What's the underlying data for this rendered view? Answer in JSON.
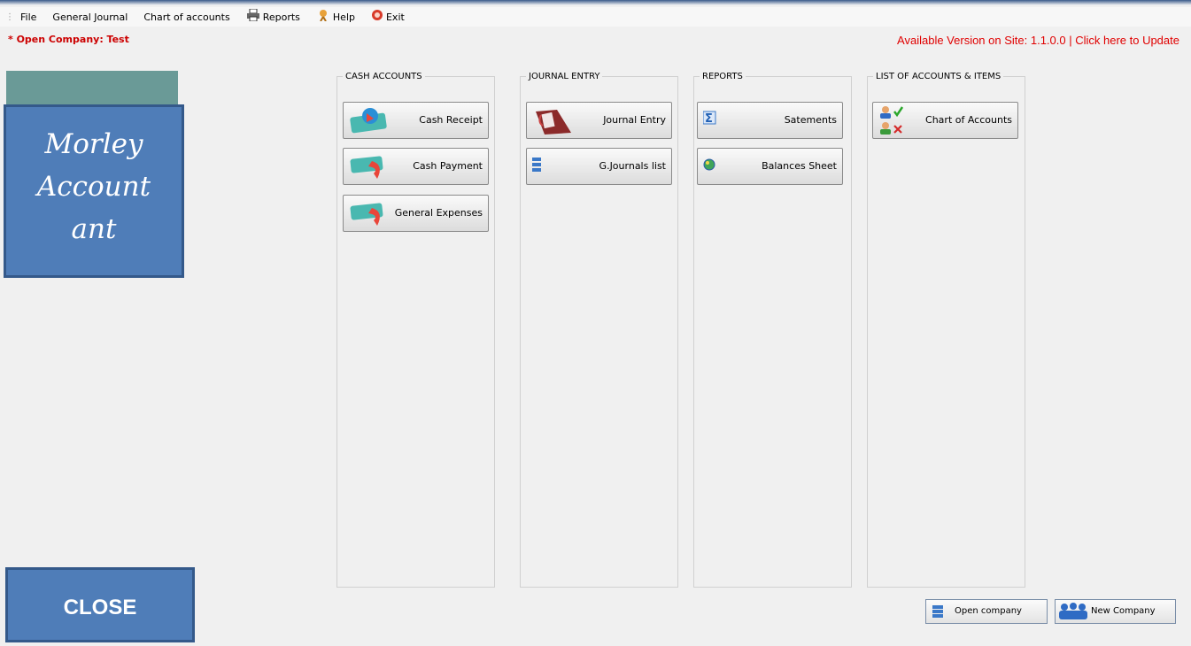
{
  "menu": {
    "items": [
      {
        "label": "File",
        "icon": ""
      },
      {
        "label": "General Journal",
        "icon": ""
      },
      {
        "label": "Chart of accounts",
        "icon": ""
      },
      {
        "label": "Reports",
        "icon": "printer-icon"
      },
      {
        "label": "Help",
        "icon": "help-icon"
      },
      {
        "label": "Exit",
        "icon": "exit-icon"
      }
    ]
  },
  "header": {
    "open_company": "* Open Company: Test",
    "update_notice": "Available Version on Site: 1.1.0.0 | Click here to Update"
  },
  "logo": {
    "text_line1": "Morley",
    "text_line2": "Account",
    "text_line3": "ant"
  },
  "groups": [
    {
      "title": "CASH ACCOUNTS",
      "buttons": [
        "Cash Receipt",
        "Cash Payment",
        "General Expenses"
      ]
    },
    {
      "title": "JOURNAL ENTRY",
      "buttons": [
        "Journal Entry",
        "G.Journals list"
      ]
    },
    {
      "title": "REPORTS",
      "buttons": [
        "Satements",
        "Balances Sheet"
      ]
    },
    {
      "title": "LIST OF ACCOUNTS & ITEMS",
      "buttons": [
        "Chart of Accounts"
      ]
    }
  ],
  "footer": {
    "close_label": "CLOSE",
    "open_company_label": "Open company",
    "new_company_label": "New Company"
  },
  "colors": {
    "accent_blue": "#4f7db8",
    "teal": "#6a9a97",
    "alert_red": "#e00000"
  }
}
